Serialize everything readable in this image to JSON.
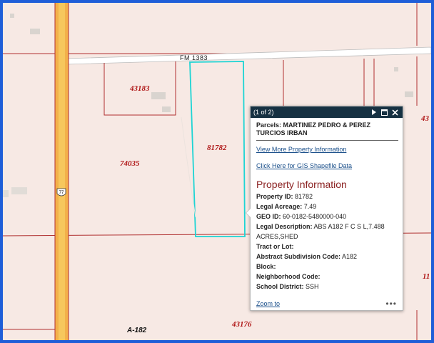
{
  "map": {
    "road_label": "FM 1383",
    "highway_shield": "77",
    "survey_label": "A-182",
    "parcels": [
      "43183",
      "81782",
      "74035",
      "43176",
      "43",
      "11"
    ]
  },
  "popup": {
    "count": "(1 of 2)",
    "title": "Parcels: MARTINEZ PEDRO & PEREZ TURCIOS IRBAN",
    "link1": "View More Property Information",
    "link2": "Click Here for GIS Shapefile Data",
    "section_title": "Property Information",
    "fields": [
      {
        "label": "Property ID:",
        "value": "81782"
      },
      {
        "label": "Legal Acreage:",
        "value": "7.49"
      },
      {
        "label": "GEO ID:",
        "value": "60-0182-5480000-040"
      },
      {
        "label": "Legal Description:",
        "value": "ABS A182 F C S L,7.488 ACRES,SHED"
      },
      {
        "label": "Tract or Lot:",
        "value": ""
      },
      {
        "label": "Abstract Subdivision Code:",
        "value": "A182"
      },
      {
        "label": "Block:",
        "value": ""
      },
      {
        "label": "Neighborhood Code:",
        "value": ""
      },
      {
        "label": "School District:",
        "value": "SSH"
      }
    ],
    "zoom_to": "Zoom to",
    "more": "•••"
  }
}
